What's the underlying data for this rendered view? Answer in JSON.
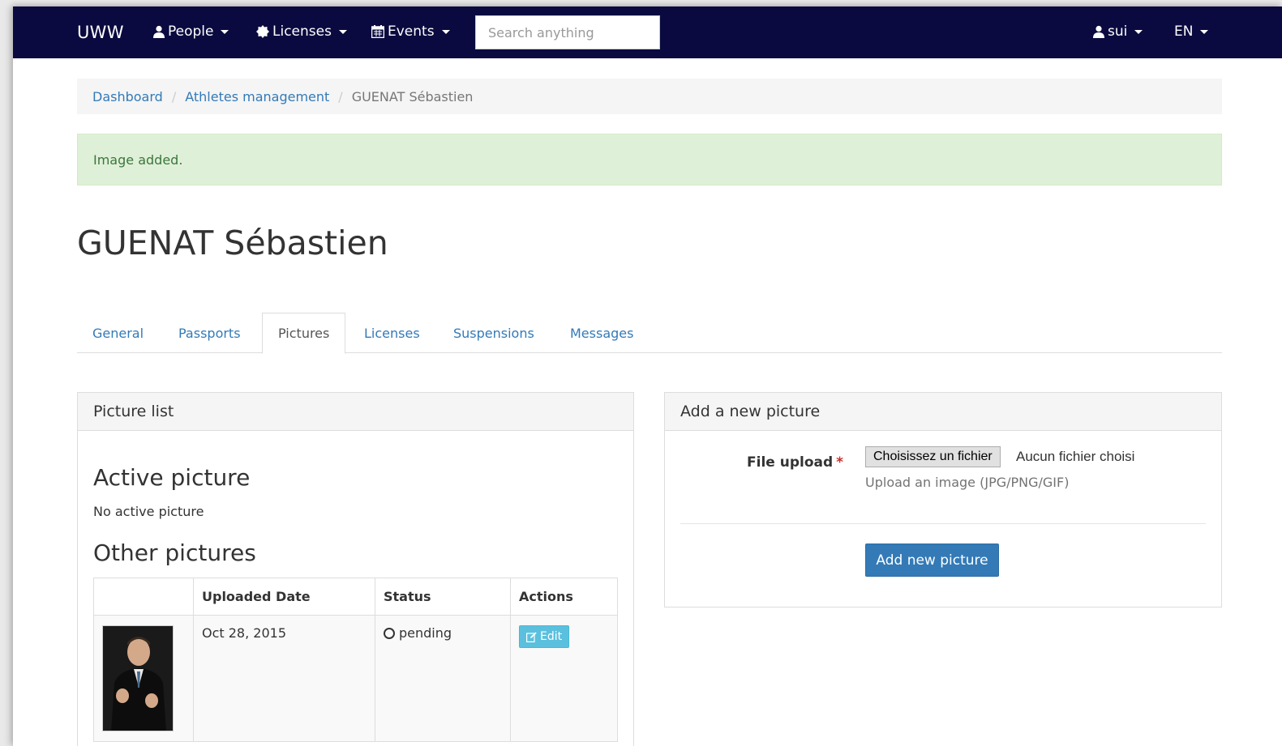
{
  "navbar": {
    "brand": "UWW",
    "people": "People",
    "licenses": "Licenses",
    "events": "Events",
    "search_placeholder": "Search anything",
    "user": "sui",
    "language": "EN"
  },
  "breadcrumb": {
    "dashboard": "Dashboard",
    "athletes": "Athletes management",
    "current": "GUENAT Sébastien"
  },
  "alert": {
    "message": "Image added."
  },
  "page": {
    "title": "GUENAT Sébastien"
  },
  "tabs": [
    "General",
    "Passports",
    "Pictures",
    "Licenses",
    "Suspensions",
    "Messages"
  ],
  "picture_list": {
    "heading": "Picture list",
    "active_title": "Active picture",
    "active_empty": "No active picture",
    "other_title": "Other pictures",
    "columns": [
      "",
      "Uploaded Date",
      "Status",
      "Actions"
    ],
    "rows": [
      {
        "date": "Oct 28, 2015",
        "status": "pending",
        "action": "Edit"
      }
    ]
  },
  "add_picture": {
    "heading": "Add a new picture",
    "label": "File upload",
    "required_mark": "*",
    "file_button": "Choisissez un fichier",
    "file_status": "Aucun fichier choisi",
    "help": "Upload an image (JPG/PNG/GIF)",
    "submit": "Add new picture"
  },
  "colors": {
    "navbar": "#0a0a40",
    "link": "#337ab7",
    "success_bg": "#dff0d8",
    "success_text": "#3c763d",
    "primary": "#337ab7",
    "info": "#5bc0de"
  }
}
